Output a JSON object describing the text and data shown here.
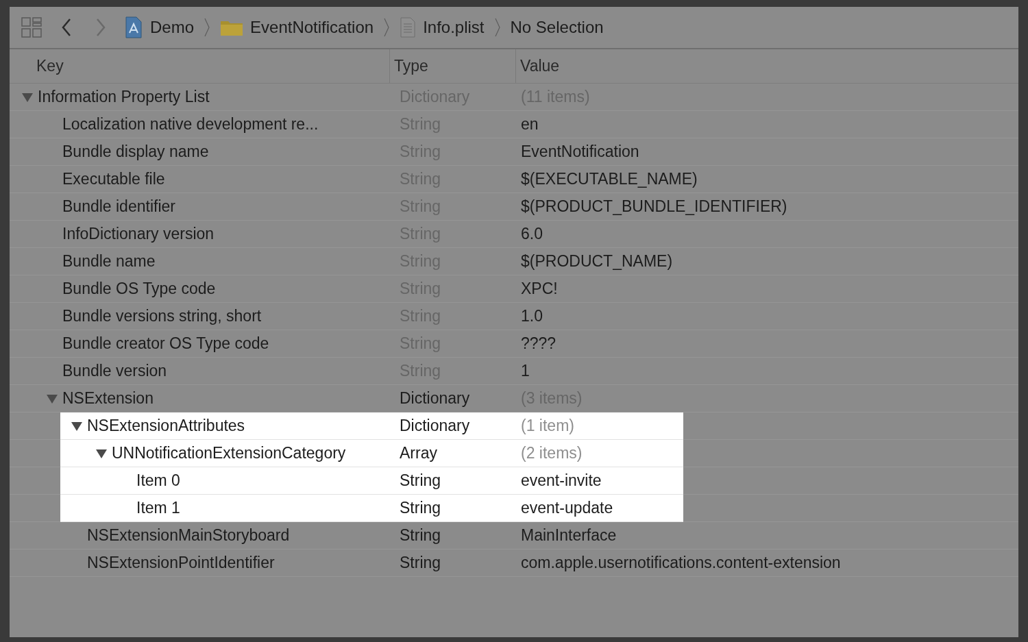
{
  "toolbar": {
    "breadcrumbs": [
      {
        "kind": "project",
        "label": "Demo"
      },
      {
        "kind": "folder",
        "label": "EventNotification"
      },
      {
        "kind": "file",
        "label": "Info.plist"
      },
      {
        "kind": "plain",
        "label": "No Selection"
      }
    ]
  },
  "table": {
    "columns": [
      "Key",
      "Type",
      "Value"
    ],
    "rows": [
      {
        "key": "Information Property List",
        "type": "Dictionary",
        "value": "(11 items)",
        "type_muted": true,
        "value_muted": true,
        "highlighted": false,
        "expanded": true,
        "children": [
          {
            "key": "Localization native development re...",
            "type": "String",
            "value": "en",
            "type_muted": true,
            "value_muted": false,
            "highlighted": false
          },
          {
            "key": "Bundle display name",
            "type": "String",
            "value": "EventNotification",
            "type_muted": true,
            "value_muted": false,
            "highlighted": false
          },
          {
            "key": "Executable file",
            "type": "String",
            "value": "$(EXECUTABLE_NAME)",
            "type_muted": true,
            "value_muted": false,
            "highlighted": false
          },
          {
            "key": "Bundle identifier",
            "type": "String",
            "value": "$(PRODUCT_BUNDLE_IDENTIFIER)",
            "type_muted": true,
            "value_muted": false,
            "highlighted": false
          },
          {
            "key": "InfoDictionary version",
            "type": "String",
            "value": "6.0",
            "type_muted": true,
            "value_muted": false,
            "highlighted": false
          },
          {
            "key": "Bundle name",
            "type": "String",
            "value": "$(PRODUCT_NAME)",
            "type_muted": true,
            "value_muted": false,
            "highlighted": false
          },
          {
            "key": "Bundle OS Type code",
            "type": "String",
            "value": "XPC!",
            "type_muted": true,
            "value_muted": false,
            "highlighted": false
          },
          {
            "key": "Bundle versions string, short",
            "type": "String",
            "value": "1.0",
            "type_muted": true,
            "value_muted": false,
            "highlighted": false
          },
          {
            "key": "Bundle creator OS Type code",
            "type": "String",
            "value": "????",
            "type_muted": true,
            "value_muted": false,
            "highlighted": false
          },
          {
            "key": "Bundle version",
            "type": "String",
            "value": "1",
            "type_muted": true,
            "value_muted": false,
            "highlighted": false
          },
          {
            "key": "NSExtension",
            "type": "Dictionary",
            "value": "(3 items)",
            "type_muted": false,
            "value_muted": true,
            "highlighted": false,
            "expanded": true,
            "children": [
              {
                "key": "NSExtensionAttributes",
                "type": "Dictionary",
                "value": "(1 item)",
                "type_muted": false,
                "value_muted": true,
                "highlighted": true,
                "expanded": true,
                "children": [
                  {
                    "key": "UNNotificationExtensionCategory",
                    "type": "Array",
                    "value": "(2 items)",
                    "type_muted": false,
                    "value_muted": true,
                    "highlighted": true,
                    "expanded": true,
                    "children": [
                      {
                        "key": "Item 0",
                        "type": "String",
                        "value": "event-invite",
                        "type_muted": false,
                        "value_muted": false,
                        "highlighted": true
                      },
                      {
                        "key": "Item 1",
                        "type": "String",
                        "value": "event-update",
                        "type_muted": false,
                        "value_muted": false,
                        "highlighted": true
                      }
                    ]
                  }
                ]
              },
              {
                "key": "NSExtensionMainStoryboard",
                "type": "String",
                "value": "MainInterface",
                "type_muted": false,
                "value_muted": false,
                "highlighted": false
              },
              {
                "key": "NSExtensionPointIdentifier",
                "type": "String",
                "value": "com.apple.usernotifications.content-extension",
                "type_muted": false,
                "value_muted": false,
                "highlighted": false
              }
            ]
          }
        ]
      }
    ]
  }
}
